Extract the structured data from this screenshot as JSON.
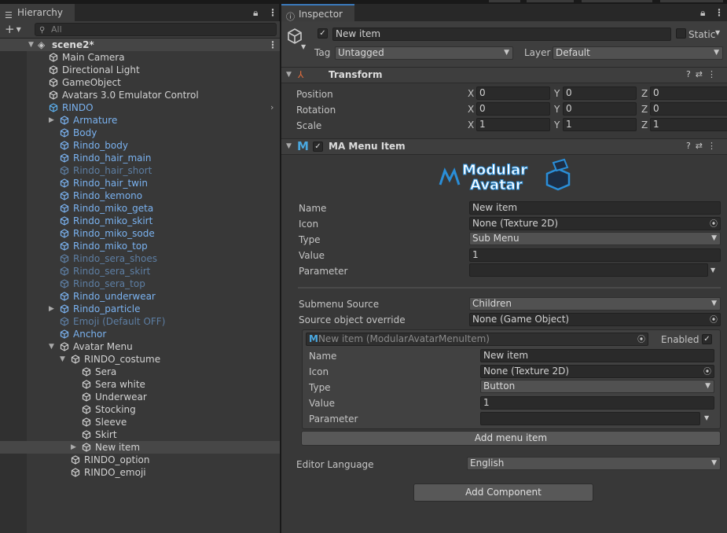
{
  "hierarchy": {
    "tab_label": "Hierarchy",
    "search_placeholder": "All",
    "scene_name": "scene2*",
    "items": [
      {
        "label": "Main Camera",
        "color": "white"
      },
      {
        "label": "Directional Light",
        "color": "white"
      },
      {
        "label": "GameObject",
        "color": "white"
      },
      {
        "label": "Avatars 3.0 Emulator Control",
        "color": "white"
      },
      {
        "label": "RINDO",
        "color": "blue"
      },
      {
        "label": "Armature",
        "color": "blue"
      },
      {
        "label": "Body",
        "color": "blue"
      },
      {
        "label": "Rindo_body",
        "color": "blue"
      },
      {
        "label": "Rindo_hair_main",
        "color": "blue"
      },
      {
        "label": "Rindo_hair_short",
        "color": "dim"
      },
      {
        "label": "Rindo_hair_twin",
        "color": "blue"
      },
      {
        "label": "Rindo_kemono",
        "color": "blue"
      },
      {
        "label": "Rindo_miko_geta",
        "color": "blue"
      },
      {
        "label": "Rindo_miko_skirt",
        "color": "blue"
      },
      {
        "label": "Rindo_miko_sode",
        "color": "blue"
      },
      {
        "label": "Rindo_miko_top",
        "color": "blue"
      },
      {
        "label": "Rindo_sera_shoes",
        "color": "dim"
      },
      {
        "label": "Rindo_sera_skirt",
        "color": "dim"
      },
      {
        "label": "Rindo_sera_top",
        "color": "dim"
      },
      {
        "label": "Rindo_underwear",
        "color": "blue"
      },
      {
        "label": "Rindo_particle",
        "color": "blue"
      },
      {
        "label": "Emoji (Default OFF)",
        "color": "dim"
      },
      {
        "label": "Anchor",
        "color": "blue"
      },
      {
        "label": "Avatar Menu",
        "color": "white"
      },
      {
        "label": "RINDO_costume",
        "color": "white"
      },
      {
        "label": "Sera",
        "color": "white"
      },
      {
        "label": "Sera white",
        "color": "white"
      },
      {
        "label": "Underwear",
        "color": "white"
      },
      {
        "label": "Stocking",
        "color": "white"
      },
      {
        "label": "Sleeve",
        "color": "white"
      },
      {
        "label": "Skirt",
        "color": "white"
      },
      {
        "label": "New item",
        "color": "white"
      },
      {
        "label": "RINDO_option",
        "color": "white"
      },
      {
        "label": "RINDO_emoji",
        "color": "white"
      }
    ]
  },
  "inspector": {
    "tab_label": "Inspector",
    "object_name": "New item",
    "static_label": "Static",
    "tag_label": "Tag",
    "tag_value": "Untagged",
    "layer_label": "Layer",
    "layer_value": "Default",
    "transform": {
      "title": "Transform",
      "position_label": "Position",
      "rotation_label": "Rotation",
      "scale_label": "Scale",
      "axis_x": "X",
      "axis_y": "Y",
      "axis_z": "Z",
      "position": [
        "0",
        "0",
        "0"
      ],
      "rotation": [
        "0",
        "0",
        "0"
      ],
      "scale": [
        "1",
        "1",
        "1"
      ]
    },
    "menu_item": {
      "title": "MA Menu Item",
      "logo_line1": "Modular",
      "logo_line2": "Avatar",
      "name_label": "Name",
      "name_value": "New item",
      "icon_label": "Icon",
      "icon_value": "None (Texture 2D)",
      "type_label": "Type",
      "type_value": "Sub Menu",
      "value_label": "Value",
      "value_value": "1",
      "parameter_label": "Parameter",
      "parameter_value": "",
      "submenu_source_label": "Submenu Source",
      "submenu_source_value": "Children",
      "source_override_label": "Source object override",
      "source_override_value": "None (Game Object)"
    },
    "child_item": {
      "ref": "New item (ModularAvatarMenuItem)",
      "enabled_label": "Enabled",
      "name_label": "Name",
      "name_value": "New item",
      "icon_label": "Icon",
      "icon_value": "None (Texture 2D)",
      "type_label": "Type",
      "type_value": "Button",
      "value_label": "Value",
      "value_value": "1",
      "parameter_label": "Parameter",
      "parameter_value": ""
    },
    "add_menu_item_label": "Add menu item",
    "editor_language_label": "Editor Language",
    "editor_language_value": "English",
    "add_component_label": "Add Component"
  }
}
